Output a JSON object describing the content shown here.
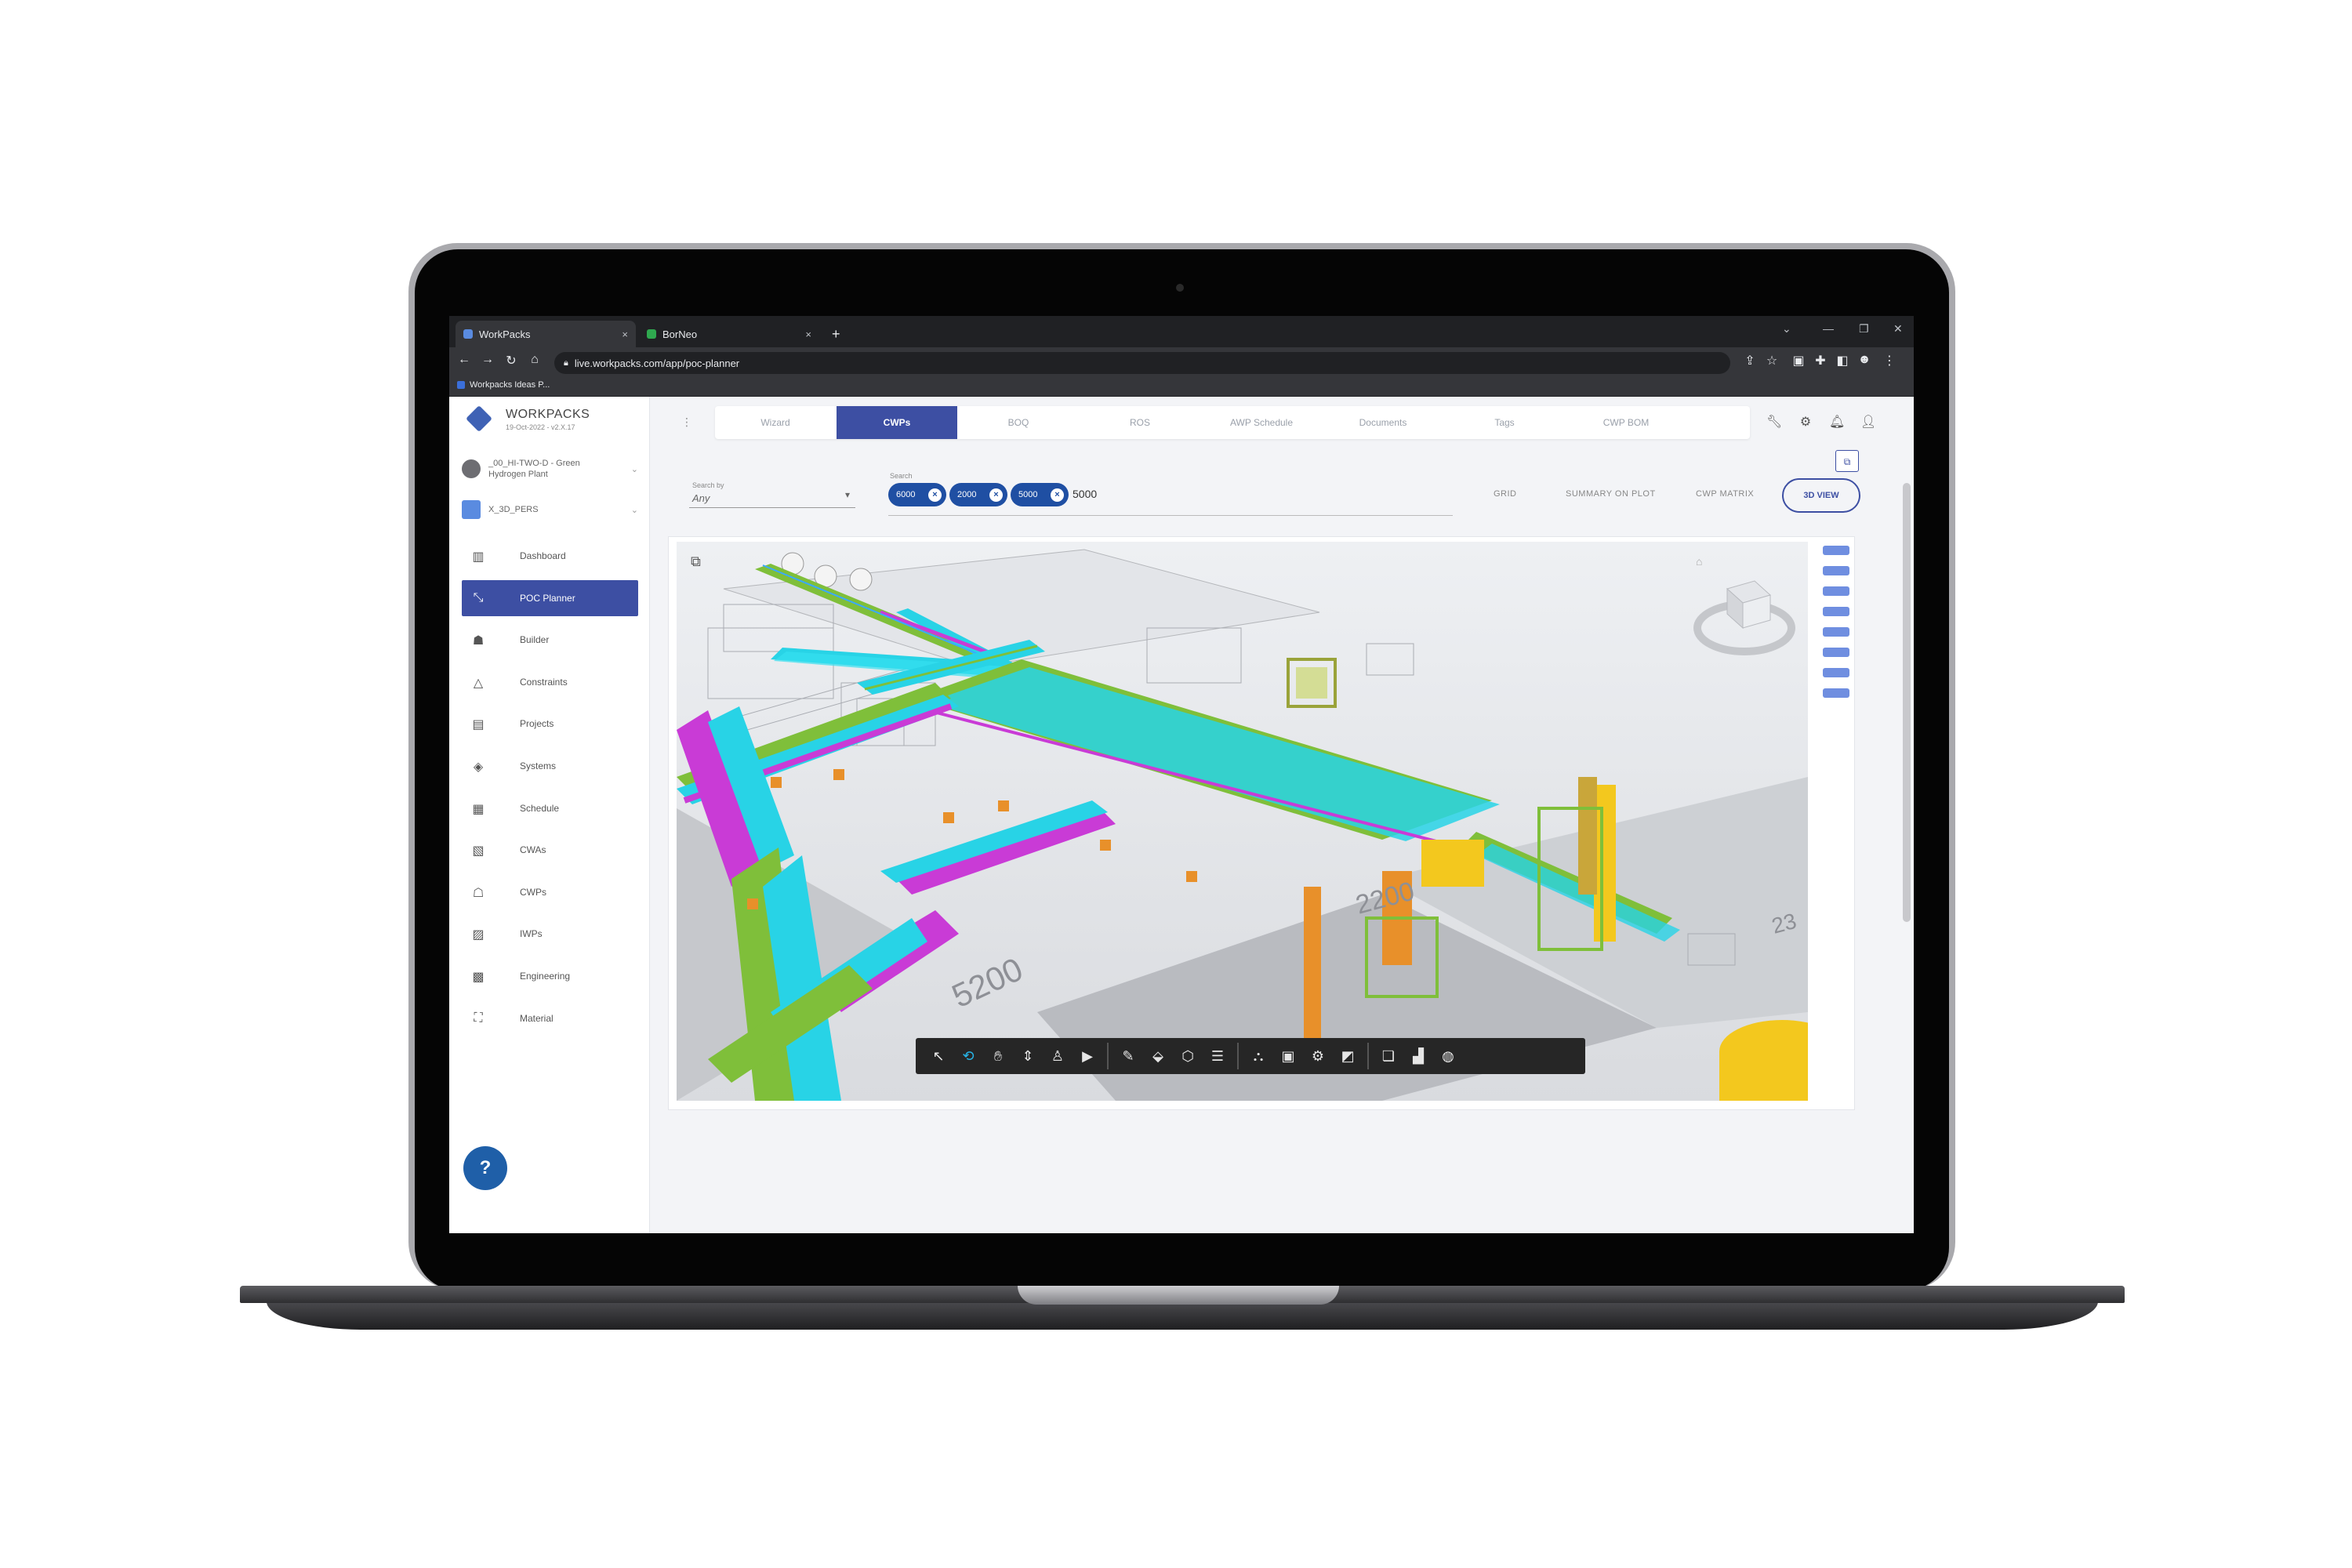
{
  "browser": {
    "tabs": [
      {
        "label": "WorkPacks",
        "close": "×"
      },
      {
        "label": "BorNeo",
        "close": "×"
      }
    ],
    "new_tab": "+",
    "window_controls": [
      "⌄",
      "—",
      "❐",
      "✕"
    ],
    "url": "live.workpacks.com/app/poc-planner",
    "bookmark": "Workpacks Ideas P..."
  },
  "app": {
    "brand": "WORKPACKS",
    "brand_sub": "19-Oct-2022 - v2.X.17",
    "projects": [
      {
        "line1": "_00_HI-TWO-D - Green",
        "line2": "Hydrogen Plant"
      },
      {
        "line1": "X_3D_PERS",
        "line2": ""
      }
    ],
    "nav": [
      {
        "label": "Dashboard",
        "icon": "dashboard-icon",
        "glyph": "▥"
      },
      {
        "label": "POC Planner",
        "icon": "planner-icon",
        "glyph": "⤡",
        "active": true
      },
      {
        "label": "Builder",
        "icon": "builder-icon",
        "glyph": "☗"
      },
      {
        "label": "Constraints",
        "icon": "constraints-icon",
        "glyph": "△"
      },
      {
        "label": "Projects",
        "icon": "projects-icon",
        "glyph": "▤"
      },
      {
        "label": "Systems",
        "icon": "systems-icon",
        "glyph": "◈"
      },
      {
        "label": "Schedule",
        "icon": "schedule-icon",
        "glyph": "▦"
      },
      {
        "label": "CWAs",
        "icon": "cwas-icon",
        "glyph": "▧"
      },
      {
        "label": "CWPs",
        "icon": "cwps-icon",
        "glyph": "☖"
      },
      {
        "label": "IWPs",
        "icon": "iwps-icon",
        "glyph": "▨"
      },
      {
        "label": "Engineering",
        "icon": "engineering-icon",
        "glyph": "▩"
      },
      {
        "label": "Material",
        "icon": "material-icon",
        "glyph": "⛶"
      }
    ],
    "top_tabs": [
      "Wizard",
      "CWPs",
      "BOQ",
      "ROS",
      "AWP Schedule",
      "Documents",
      "Tags",
      "CWP BOM"
    ],
    "active_tab": "CWPs",
    "search_by_label": "Search by",
    "search_by_value": "Any",
    "search_label": "Search",
    "chips": [
      "6000",
      "2000",
      "5000"
    ],
    "search_text": "5000",
    "views": [
      "GRID",
      "SUMMARY ON PLOT",
      "CWP MATRIX",
      "3D VIEW"
    ],
    "active_view": "3D VIEW",
    "model_labels": [
      "5200",
      "2200",
      "23"
    ]
  },
  "colors": {
    "accent": "#3d4fa3",
    "chip": "#1f4fa3",
    "pipe_cyan": "#28d3e6",
    "pipe_magenta": "#c93bd6",
    "pipe_green": "#7fbf3a",
    "yellow": "#f3c81e",
    "orange": "#e8902a"
  }
}
